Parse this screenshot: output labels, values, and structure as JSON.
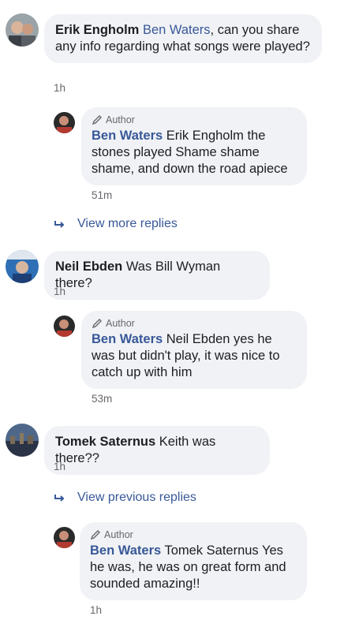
{
  "threads": [
    {
      "comment": {
        "name": "Erik Engholm",
        "mention": "Ben Waters",
        "text": ", can you share any info regarding what songs were played?",
        "time": "1h"
      },
      "reply": {
        "badge": "Author",
        "name": "Ben Waters",
        "text": " Erik Engholm the stones played Shame shame shame, and down the road apiece",
        "time": "51m"
      },
      "more_link": "View more replies"
    },
    {
      "comment": {
        "name": "Neil Ebden",
        "text": " Was Bill Wyman there?",
        "time": "1h"
      },
      "reply": {
        "badge": "Author",
        "name": "Ben Waters",
        "text": " Neil Ebden yes he was but didn't play, it was nice to catch up with him",
        "time": "53m"
      }
    },
    {
      "comment": {
        "name": "Tomek Saternus",
        "text": " Keith was there??",
        "time": "1h"
      },
      "more_link": "View previous replies",
      "reply": {
        "badge": "Author",
        "name": "Ben Waters",
        "text": " Tomek Saternus Yes he was, he was on great form and sounded amazing!!",
        "time": "1h"
      }
    }
  ],
  "colors": {
    "link": "#385898",
    "bubble": "#f0f2f5",
    "meta": "#65676b"
  },
  "icons": {
    "author_badge": "pencil-icon",
    "reply_arrow": "reply-arrow-icon"
  }
}
